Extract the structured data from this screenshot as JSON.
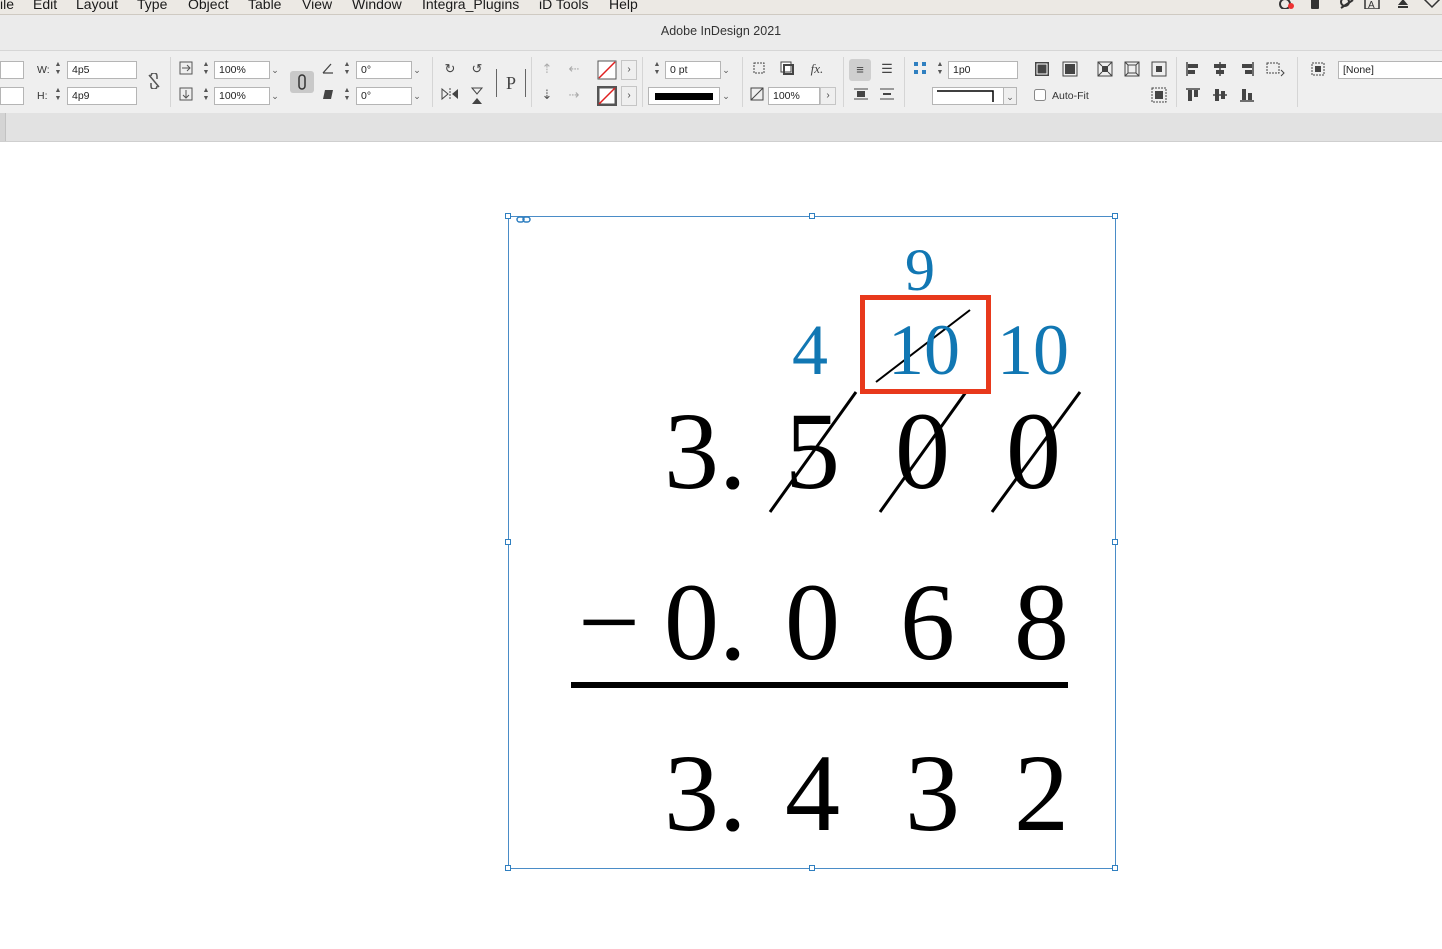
{
  "menu": {
    "items": [
      "ile",
      "Edit",
      "Layout",
      "Type",
      "Object",
      "Table",
      "View",
      "Window",
      "Integra_Plugins",
      "iD Tools",
      "Help"
    ]
  },
  "window": {
    "title": "Adobe InDesign 2021"
  },
  "control_panel": {
    "w_label": "W:",
    "w_value": "4p5",
    "h_label": "H:",
    "h_value": "4p9",
    "scale_x": "100%",
    "scale_y": "100%",
    "rotate_angle": "0°",
    "shear_angle": "0°",
    "stroke_weight": "0 pt",
    "opacity": "100%",
    "spacing_value": "1p0",
    "autofit_label": "Auto-Fit",
    "object_style": "[None]"
  },
  "document": {
    "borrow_top": "9",
    "borrow_row": [
      "4",
      "10",
      "10"
    ],
    "minuend": {
      "whole": "3.",
      "digits": [
        "5",
        "0",
        "0"
      ]
    },
    "subtrahend": {
      "sign": "−",
      "whole": "0.",
      "digits": [
        "0",
        "6",
        "8"
      ]
    },
    "result": {
      "whole": "3.",
      "digits": [
        "4",
        "3",
        "2"
      ]
    }
  },
  "colors": {
    "accent_blue": "#1177b3",
    "highlight_red": "#e8391c",
    "frame_blue": "#2f7fc0"
  }
}
